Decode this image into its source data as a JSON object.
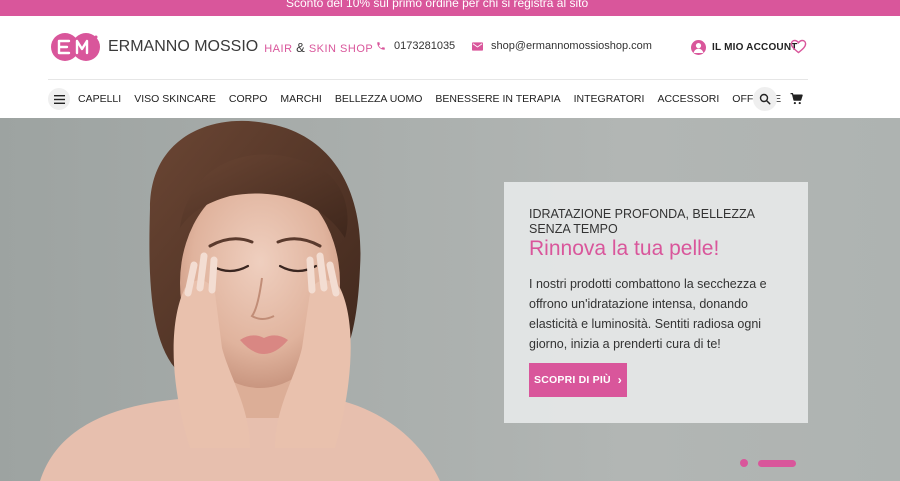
{
  "promo": {
    "text": "Sconto del 10% sul primo ordine per chi si registra al sito"
  },
  "logo": {
    "brand": "ERMANNO MOSSIO",
    "tag_left": "HAIR",
    "tag_amp": "&",
    "tag_right": "SKIN SHOP",
    "icon": "em-monogram-logo"
  },
  "contact": {
    "phone": "0173281035",
    "email": "shop@ermannomossioshop.com",
    "phone_icon": "phone-icon",
    "email_icon": "envelope-icon"
  },
  "account": {
    "label": "IL MIO ACCOUNT",
    "icon": "user-avatar-icon",
    "wishlist_icon": "heart-icon"
  },
  "nav": {
    "menu_icon": "hamburger-icon",
    "items": [
      {
        "label": "CAPELLI"
      },
      {
        "label": "VISO SKINCARE"
      },
      {
        "label": "CORPO"
      },
      {
        "label": "MARCHI"
      },
      {
        "label": "BELLEZZA UOMO"
      },
      {
        "label": "BENESSERE IN TERAPIA"
      },
      {
        "label": "INTEGRATORI"
      },
      {
        "label": "ACCESSORI"
      },
      {
        "label": "OFFERTE"
      }
    ],
    "search_icon": "search-icon",
    "cart_icon": "cart-icon"
  },
  "hero": {
    "eyebrow": "IDRATAZIONE PROFONDA, BELLEZZA SENZA TEMPO",
    "title": "Rinnova la tua pelle!",
    "body": "I nostri prodotti combattono la secchezza e offrono un'idratazione intensa, donando elasticità e luminosità. Sentiti radiosa ogni giorno, inizia a prenderti cura di te!",
    "cta": "SCOPRI DI PIÙ",
    "cta_icon": "chevron-right-icon",
    "slides_total": 2,
    "slide_active": 2
  },
  "colors": {
    "accent": "#d9569b",
    "hero_bg": "#aab0ae",
    "card_bg": "#e5e7e7"
  }
}
